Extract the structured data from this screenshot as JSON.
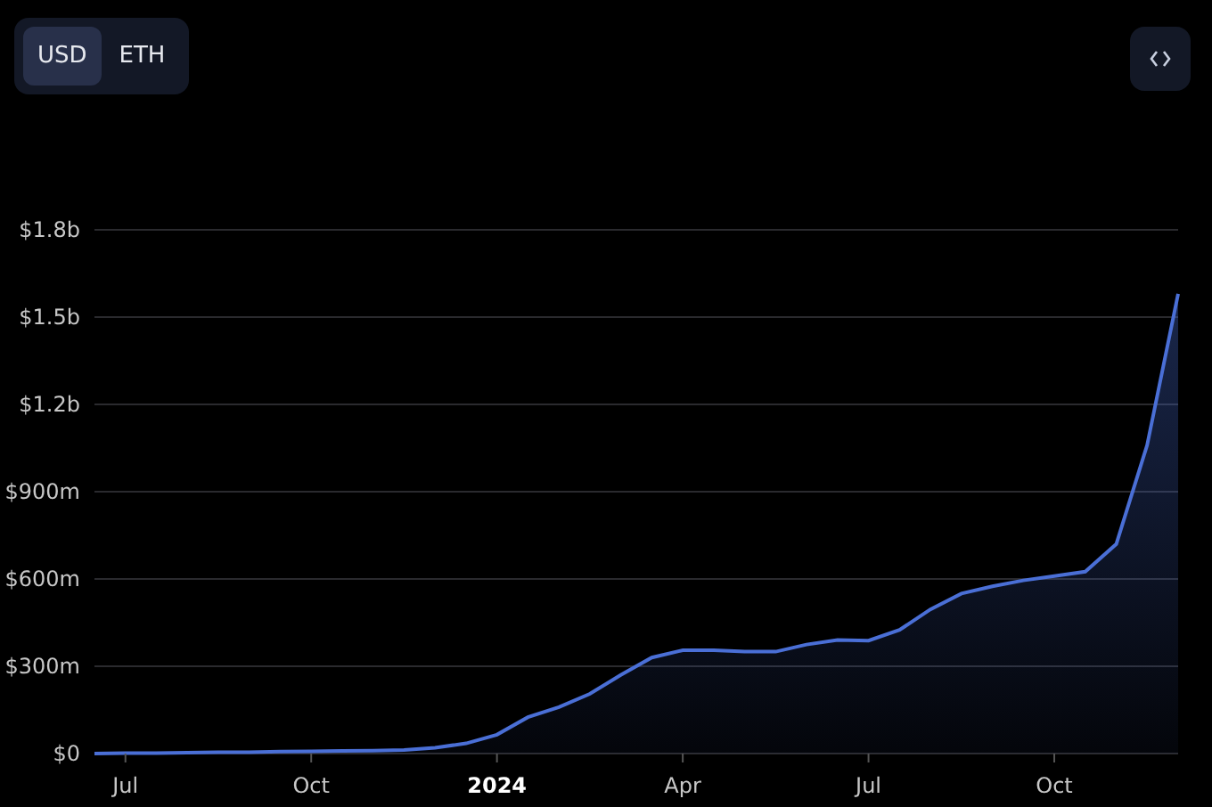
{
  "currency_toggle": [
    {
      "label": "USD",
      "selected": true
    },
    {
      "label": "ETH",
      "selected": false
    }
  ],
  "chart": {
    "chart_data": {
      "type": "area",
      "categories": [
        null,
        "Jul",
        null,
        null,
        null,
        null,
        null,
        "Oct",
        null,
        null,
        null,
        null,
        null,
        "2024",
        null,
        null,
        null,
        null,
        null,
        "Apr",
        null,
        null,
        null,
        null,
        null,
        "Jul",
        null,
        null,
        null,
        null,
        null,
        "Oct",
        null,
        null,
        null,
        null
      ],
      "grid": true,
      "series": [
        {
          "color": "#4a6fd6",
          "values": [
            0,
            1000000,
            2000000,
            3000000,
            4000000,
            5000000,
            7000000,
            8000000,
            9000000,
            10000000,
            12000000,
            20000000,
            35000000,
            65000000,
            125000000,
            160000000,
            205000000,
            270000000,
            330000000,
            355000000,
            355000000,
            350000000,
            350000000,
            375000000,
            390000000,
            388000000,
            425000000,
            495000000,
            550000000,
            575000000,
            595000000,
            610000000,
            625000000,
            720000000,
            1060000000,
            1580000000
          ]
        }
      ],
      "ylim": [
        0,
        1800000000
      ],
      "yticks": [
        {
          "value": 0,
          "label": "$0"
        },
        {
          "value": 300000000,
          "label": "$300m"
        },
        {
          "value": 600000000,
          "label": "$600m"
        },
        {
          "value": 900000000,
          "label": "$900m"
        },
        {
          "value": 1200000000,
          "label": "$1.2b"
        },
        {
          "value": 1500000000,
          "label": "$1.5b"
        },
        {
          "value": 1800000000,
          "label": "$1.8b"
        }
      ]
    }
  }
}
